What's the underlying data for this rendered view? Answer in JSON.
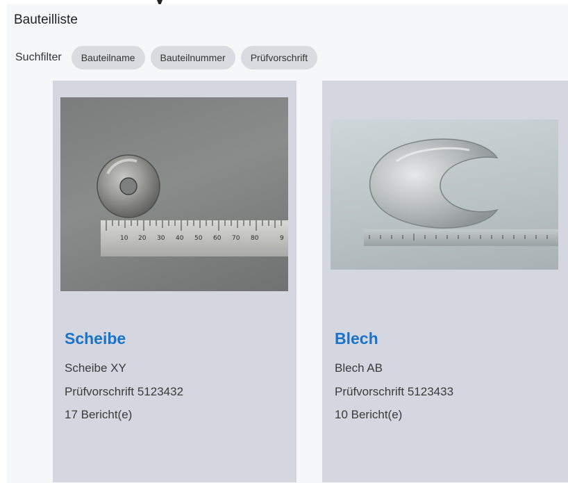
{
  "page": {
    "title": "Bauteilliste"
  },
  "filter": {
    "label": "Suchfilter",
    "chips": [
      "Bauteilname",
      "Bauteilnummer",
      "Prüfvorschrift"
    ]
  },
  "cards": [
    {
      "name": "Scheibe",
      "part_number": "Scheibe XY",
      "test_spec": "Prüfvorschrift 5123432",
      "reports": "17 Bericht(e)",
      "image": "washer-photo",
      "ruler_labels": [
        "10",
        "20",
        "30",
        "40",
        "50",
        "60",
        "70",
        "80",
        "9"
      ]
    },
    {
      "name": "Blech",
      "part_number": "Blech AB",
      "test_spec": "Prüfvorschrift 5123433",
      "reports": "10 Bericht(e)",
      "image": "sheet-metal-photo"
    }
  ],
  "colors": {
    "accent": "#1a73c9",
    "card_background": "#d4d7df",
    "chip_background": "#d9dbe0"
  }
}
